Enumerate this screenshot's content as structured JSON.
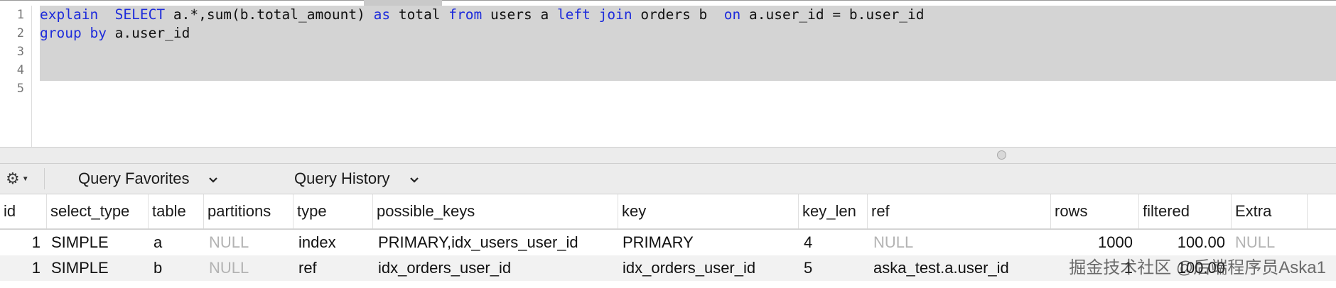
{
  "editor": {
    "line_numbers": [
      "1",
      "2",
      "3",
      "4",
      "5"
    ],
    "line1": {
      "t1": "explain",
      "t2": "  ",
      "t3": "SELECT",
      "t4": " a.*,sum(b.total_amount) ",
      "t5": "as",
      "t6": " total ",
      "t7": "from",
      "t8": " users a ",
      "t9": "left",
      "t10": " ",
      "t11": "join",
      "t12": " orders b  ",
      "t13": "on",
      "t14": " a.user_id = b.user_id"
    },
    "line2": {
      "t1": "group",
      "t2": " ",
      "t3": "by",
      "t4": " a.user_id"
    },
    "keyword_color": "#1d2bdb",
    "selection_color": "#d4d4d4"
  },
  "toolbar": {
    "gear_icon": "gear-icon",
    "favorites_label": "Query Favorites",
    "history_label": "Query History"
  },
  "results": {
    "columns": [
      "id",
      "select_type",
      "table",
      "partitions",
      "type",
      "possible_keys",
      "key",
      "key_len",
      "ref",
      "rows",
      "filtered",
      "Extra"
    ],
    "rows": [
      [
        "1",
        "SIMPLE",
        "a",
        "NULL",
        "index",
        "PRIMARY,idx_users_user_id",
        "PRIMARY",
        "4",
        "NULL",
        "1000",
        "100.00",
        "NULL"
      ],
      [
        "1",
        "SIMPLE",
        "b",
        "NULL",
        "ref",
        "idx_orders_user_id",
        "idx_orders_user_id",
        "5",
        "aska_test.a.user_id",
        "1",
        "100.00",
        ""
      ]
    ]
  },
  "watermark": "掘金技术社区 @后端程序员Aska1"
}
